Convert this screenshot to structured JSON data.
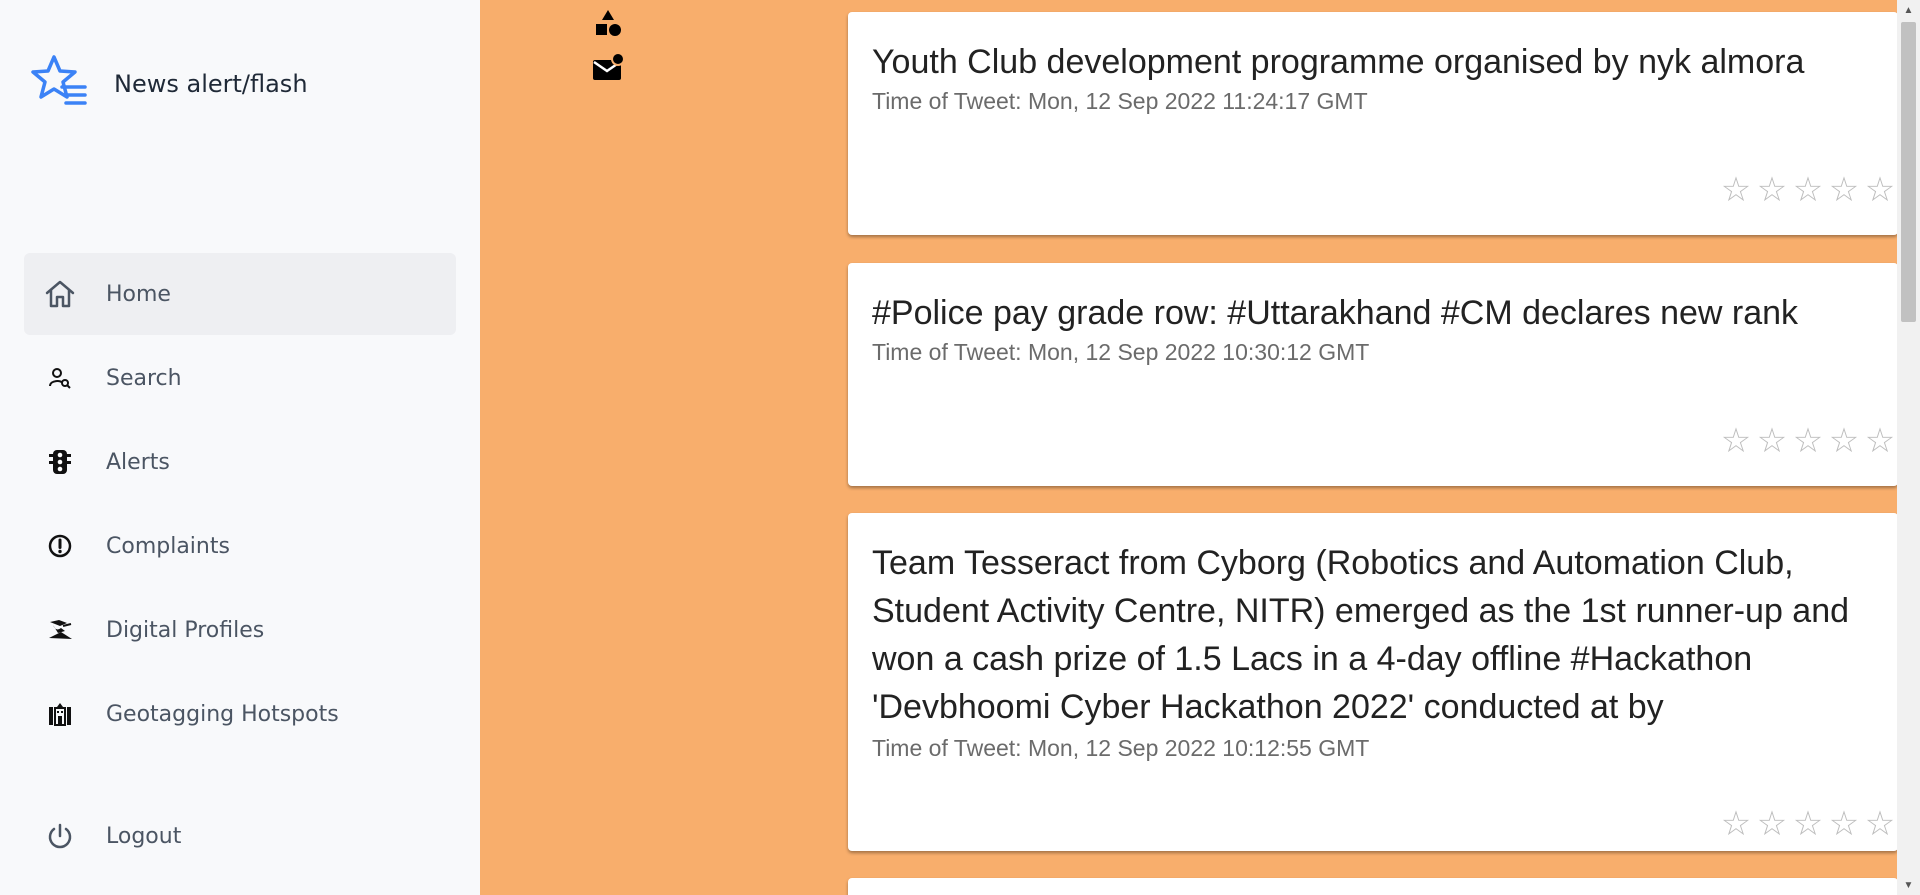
{
  "brand": {
    "title": "News alert/flash",
    "icon": "star-list-icon",
    "accent": "#3b82f6"
  },
  "sidebar": {
    "items": [
      {
        "label": "Home",
        "icon": "home-icon",
        "active": true
      },
      {
        "label": "Search",
        "icon": "user-search-icon"
      },
      {
        "label": "Alerts",
        "icon": "traffic-light-icon"
      },
      {
        "label": "Complaints",
        "icon": "exclamation-circle-icon"
      },
      {
        "label": "Digital Profiles",
        "icon": "profile-icon"
      },
      {
        "label": "Geotagging Hotspots",
        "icon": "building-icon"
      },
      {
        "label": "Logout",
        "icon": "power-icon"
      }
    ]
  },
  "toolbar": {
    "icons": [
      "shapes-icon",
      "mail-notification-icon"
    ]
  },
  "feed": {
    "background": "#f8ae6c",
    "tweets": [
      {
        "title": "Youth Club development programme organised by nyk almora",
        "time": "Time of Tweet: Mon, 12 Sep 2022 11:24:17 GMT",
        "rating": 0
      },
      {
        "title": "#Police pay grade row: #Uttarakhand #CM declares new rank",
        "time": "Time of Tweet: Mon, 12 Sep 2022 10:30:12 GMT",
        "rating": 0
      },
      {
        "title": "Team Tesseract from Cyborg (Robotics and Automation Club, Student Activity Centre, NITR) emerged as the 1st runner-up and won a cash prize of 1.5 Lacs in a 4-day offline #Hackathon 'Devbhoomi Cyber Hackathon 2022' conducted at by",
        "time": "Time of Tweet: Mon, 12 Sep 2022 10:12:55 GMT",
        "rating": 0
      }
    ],
    "star_glyph": "☆"
  }
}
